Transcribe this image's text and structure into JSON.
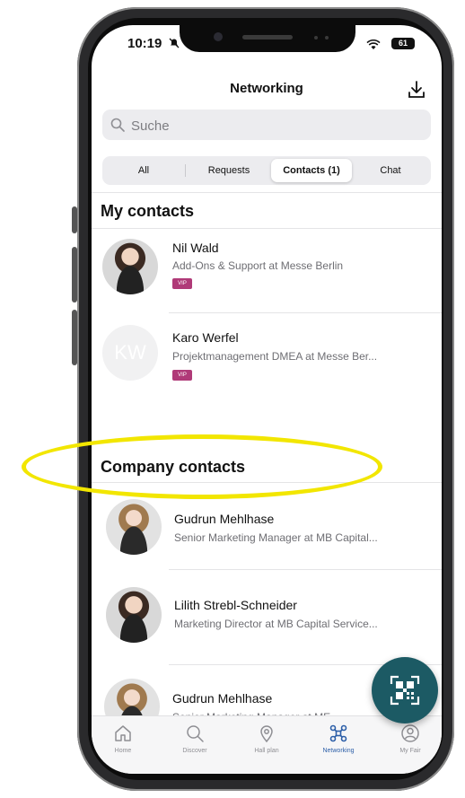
{
  "status_bar": {
    "time": "10:19",
    "battery": "61"
  },
  "header": {
    "title": "Networking",
    "icons": [
      "download-icon"
    ]
  },
  "search": {
    "placeholder": "Suche",
    "value": ""
  },
  "segments": [
    {
      "label": "All",
      "active": false
    },
    {
      "label": "Requests",
      "active": false
    },
    {
      "label": "Contacts (1)",
      "active": true
    },
    {
      "label": "Chat",
      "active": false
    }
  ],
  "my_contacts": {
    "title": "My contacts",
    "items": [
      {
        "name": "Nil Wald",
        "role": "Add-Ons & Support at Messe Berlin",
        "tag": "VIP"
      },
      {
        "name": "Karo Werfel",
        "role": "Projektmanagement DMEA at Messe Ber...",
        "tag": "VIP",
        "initials": "KW"
      }
    ]
  },
  "company_contacts": {
    "title": "Company contacts",
    "items": [
      {
        "name": "Gudrun Mehlhase",
        "role": "Senior Marketing Manager at MB Capital..."
      },
      {
        "name": "Lilith Strebl-Schneider",
        "role": "Marketing Director at MB Capital Service..."
      },
      {
        "name": "Gudrun Mehlhase",
        "role": "Senior Marketing Manager at ME"
      }
    ]
  },
  "fab": {
    "icon": "qr-code-icon"
  },
  "tabbar": [
    {
      "label": "Home",
      "icon": "home-icon",
      "active": false
    },
    {
      "label": "Discover",
      "icon": "search-icon",
      "active": false
    },
    {
      "label": "Hall plan",
      "icon": "location-pin-icon",
      "active": false
    },
    {
      "label": "Networking",
      "icon": "networking-icon",
      "active": true
    },
    {
      "label": "My Fair",
      "icon": "profile-icon",
      "active": false
    }
  ],
  "colors": {
    "accent": "#2d5fa8",
    "fab": "#1c5a64",
    "tag": "#b03a78",
    "highlight": "#f2e600"
  }
}
